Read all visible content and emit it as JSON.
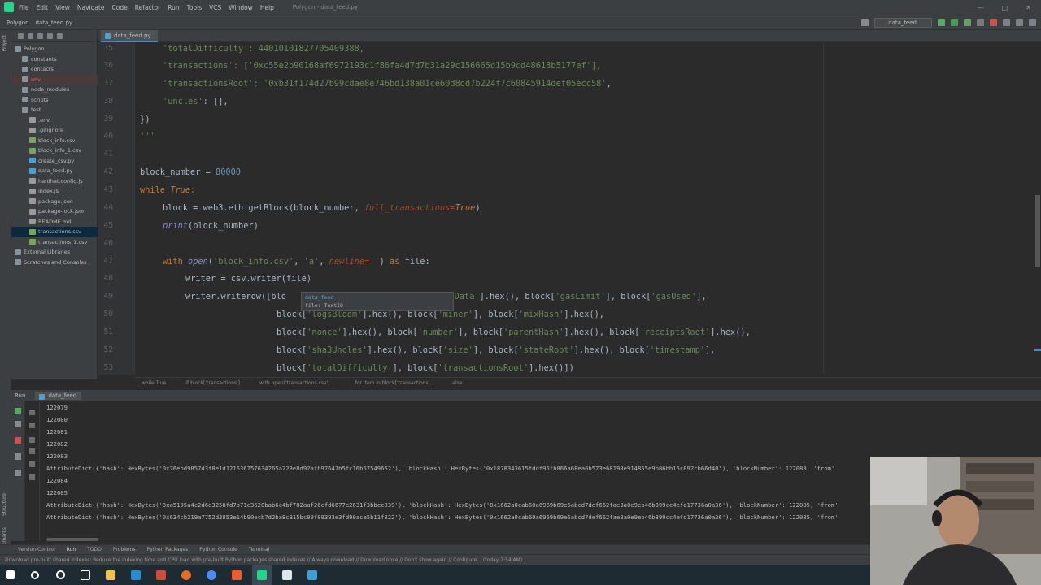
{
  "menubar": {
    "items": [
      "File",
      "Edit",
      "View",
      "Navigate",
      "Code",
      "Refactor",
      "Run",
      "Tools",
      "VCS",
      "Window",
      "Help"
    ],
    "window_title": "Polygon - data_feed.py"
  },
  "navbar": {
    "project": "Polygon",
    "file": "data_feed.py",
    "run_config": "data_feed"
  },
  "project_pane": {
    "title": "Project",
    "tree": [
      {
        "label": "Polygon",
        "level": 0,
        "kind": "folder"
      },
      {
        "label": "constants",
        "level": 1,
        "kind": "folder"
      },
      {
        "label": "contacts",
        "level": 1,
        "kind": "folder"
      },
      {
        "label": "env",
        "level": 1,
        "kind": "excluded"
      },
      {
        "label": "node_modules",
        "level": 1,
        "kind": "folder"
      },
      {
        "label": "scripts",
        "level": 1,
        "kind": "folder"
      },
      {
        "label": "test",
        "level": 1,
        "kind": "folder"
      },
      {
        "label": ".env",
        "level": 2,
        "kind": "file"
      },
      {
        "label": ".gitignore",
        "level": 2,
        "kind": "file"
      },
      {
        "label": "block_info.csv",
        "level": 2,
        "kind": "file"
      },
      {
        "label": "block_info_1.csv",
        "level": 2,
        "kind": "file"
      },
      {
        "label": "create_csv.py",
        "level": 2,
        "kind": "file"
      },
      {
        "label": "data_feed.py",
        "level": 2,
        "kind": "file"
      },
      {
        "label": "hardhat.config.js",
        "level": 2,
        "kind": "file"
      },
      {
        "label": "index.js",
        "level": 2,
        "kind": "file"
      },
      {
        "label": "package.json",
        "level": 2,
        "kind": "file"
      },
      {
        "label": "package-lock.json",
        "level": 2,
        "kind": "file"
      },
      {
        "label": "README.md",
        "level": 2,
        "kind": "file"
      },
      {
        "label": "transactions.csv",
        "level": 2,
        "kind": "selected"
      },
      {
        "label": "transactions_1.csv",
        "level": 2,
        "kind": "file"
      },
      {
        "label": "External Libraries",
        "level": 0,
        "kind": "folder"
      },
      {
        "label": "Scratches and Consoles",
        "level": 0,
        "kind": "folder"
      }
    ]
  },
  "editor": {
    "tab": "data_feed.py",
    "line_numbers": [
      "35",
      "36",
      "37",
      "38",
      "39",
      "40",
      "41",
      "42",
      "43",
      "44",
      "45",
      "46",
      "47",
      "48",
      "49",
      "50",
      "51",
      "52",
      "53"
    ],
    "tooltip_title": "data_feed",
    "tooltip_body": "file: TextIO",
    "code": {
      "l35": "'totalDifficulty': 44010101827705409388,",
      "l36a": "'transactions': [",
      "l36b": "'0xc55e2b90168af6972193c1f86fa4d7d7b31a29c156665d15b9cd48618b5177ef'",
      "l36c": "],",
      "l37a": "'transactionsRoot': ",
      "l37b": "'0xb31f174d27b99cdae8e746bd138a01ce60d8dd7b224f7c60845914def05ecc58'",
      "l37c": ",",
      "l38a": "'uncles'",
      "l38b": ": [],",
      "l39": "})",
      "l40": "'''",
      "l42a": "block_number = ",
      "l42b": "80000",
      "l43a": "while ",
      "l43b": "True",
      "l43c": ":",
      "l44a": "block = web3.eth.getBlock(block_number, ",
      "l44b": "full_transactions",
      "l44c": "=",
      "l44d": "True",
      "l44e": ")",
      "l45a": "print",
      "l45b": "(block_number)",
      "l47a": "with ",
      "l47b": "open",
      "l47c": "(",
      "l47d": "'block_info.csv'",
      "l47e": ", ",
      "l47f": "'a'",
      "l47g": ", ",
      "l47h": "newline",
      "l47i": "=",
      "l47j": "''",
      "l47k": ") ",
      "l47l": "as ",
      "l47m": "file:",
      "l48": "writer = csv.writer(file)",
      "l49a": "writer.writerow([blo",
      "l49b": "traData'",
      "l49c": "].hex(), block[",
      "l49d": "'gasLimit'",
      "l49e": "], block[",
      "l49f": "'gasUsed'",
      "l49g": "],",
      "l50a": "block[",
      "l50b": "'logsBloom'",
      "l50c": "].hex(), block[",
      "l50d": "'miner'",
      "l50e": "], block[",
      "l50f": "'mixHash'",
      "l50g": "].hex(),",
      "l51a": "block[",
      "l51b": "'nonce'",
      "l51c": "].hex(), block[",
      "l51d": "'number'",
      "l51e": "], block[",
      "l51f": "'parentHash'",
      "l51g": "].hex(), block[",
      "l51h": "'receiptsRoot'",
      "l51i": "].hex(),",
      "l52a": "block[",
      "l52b": "'sha3Uncles'",
      "l52c": "].hex(), block[",
      "l52d": "'size'",
      "l52e": "], block[",
      "l52f": "'stateRoot'",
      "l52g": "].hex(), block[",
      "l52h": "'timestamp'",
      "l52i": "],",
      "l53a": "block[",
      "l53b": "'totalDifficulty'",
      "l53c": "], block[",
      "l53d": "'transactionsRoot'",
      "l53e": "].hex()])"
    }
  },
  "breadcrumbs": [
    "while True",
    "if block['transactions']",
    "with open('transactions.csv', ...",
    "for item in block['transactions...",
    "else"
  ],
  "run_panel": {
    "label": "Run",
    "tab": "data_feed",
    "lines": [
      "122079",
      "122080",
      "122081",
      "122082",
      "122083",
      "AttributeDict({'hash': HexBytes('0x76ebd9857d3f8e1d121636757634265a223e8d92afb97647b5fc16b67549662'), 'blockHash': HexBytes('0x1878343615fddf95fb866a68ea6b573e68198e914855e9b86bb15c892cb66d40'), 'blockNumber': 122083, 'from'",
      "122084",
      "122085",
      "AttributeDict({'hash': HexBytes('0xa5195a4c2d6e3258fd7b71e3620bab6c4bf782aaf26cfd6677e2631f3bbcc039'), 'blockHash': HexBytes('0x1662a0cab60a6969b69e6abcd7def662fae3a0e9eb46b399cc4efd17736a0a36'), 'blockNumber': 122085, 'from'",
      "AttributeDict({'hash': HexBytes('0x634cb219a7752d3853e14b90ecb7d2ba8c315bc99f89393e3fd90ace5b11f822'), 'blockHash': HexBytes('0x1662a0cab60a6969b69e6abcd7def662fae3a0e9eb46b399cc4efd17736a0a36'), 'blockNumber': 122085, 'from'"
    ]
  },
  "tool_tabs": [
    "Version Control",
    "Run",
    "TODO",
    "Problems",
    "Python Packages",
    "Python Console",
    "Terminal"
  ],
  "status": "Download pre-built shared indexes: Reduce the indexing time and CPU load with pre-built Python packages shared indexes // Always download // Download once // Don't show again // Configure... (today 7:54 AM)",
  "left_strip": [
    "Project",
    "Structure",
    "Bookmarks"
  ],
  "colors": {
    "accent": "#4a88c7",
    "background": "#2b2b2b",
    "panel": "#3c3f41"
  }
}
